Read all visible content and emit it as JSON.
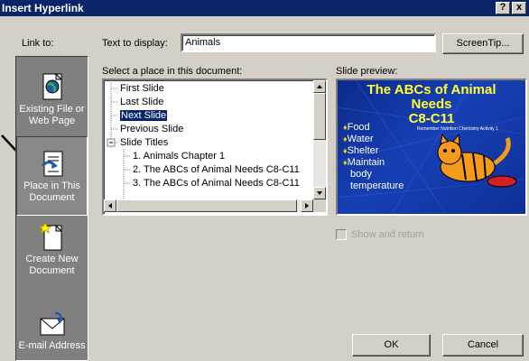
{
  "title": "Insert Hyperlink",
  "title_buttons": {
    "help": "?",
    "close": "x"
  },
  "link_to_label": "Link to:",
  "rail": [
    {
      "line1": "Existing File or",
      "line2": "Web Page",
      "icon": "globe-page-icon"
    },
    {
      "line1": "Place in This",
      "line2": "Document",
      "icon": "document-place-icon"
    },
    {
      "line1": "Create New",
      "line2": "Document",
      "icon": "new-document-icon"
    },
    {
      "line1": "E-mail Address",
      "line2": "",
      "icon": "email-envelope-icon"
    }
  ],
  "text_to_display": {
    "label": "Text to display:",
    "value": "Animals"
  },
  "screentip_button": "ScreenTip...",
  "select_place_label": "Select a place in this document:",
  "tree": {
    "items": [
      {
        "label": "First Slide",
        "selected": false
      },
      {
        "label": "Last Slide",
        "selected": false
      },
      {
        "label": "Next Slide",
        "selected": true
      },
      {
        "label": "Previous Slide",
        "selected": false
      },
      {
        "label": "Slide Titles",
        "selected": false,
        "expander": "-"
      },
      {
        "label": "1. Animals Chapter 1",
        "selected": false
      },
      {
        "label": "2. The ABCs of Animal Needs C8-C11",
        "selected": false
      },
      {
        "label": "3. The ABCs of Animal Needs C8-C11",
        "selected": false
      }
    ]
  },
  "slide_preview_label": "Slide preview:",
  "slide_preview": {
    "title_line1": "The ABCs of Animal",
    "title_line2": "Needs",
    "title_line3": "C8-C11",
    "subtitle": "Remember Nutrition Chemistry Activity 1",
    "bullets": [
      "Food",
      "Water",
      "Shelter",
      "Maintain",
      "body",
      "temperature"
    ],
    "colors": {
      "background": "#1740b5",
      "title": "#ffff33",
      "bullet": "#ffcc00"
    }
  },
  "show_and_return": {
    "label": "Show and return",
    "checked": false,
    "enabled": false
  },
  "ok_button": "OK",
  "cancel_button": "Cancel"
}
